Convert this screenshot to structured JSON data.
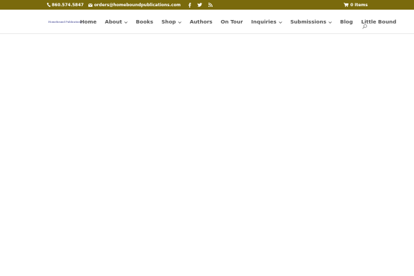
{
  "topbar": {
    "phone": "860.574.5847",
    "email": "orders@homeboundpublications.com",
    "social_icons": [
      "facebook-icon",
      "twitter-icon",
      "rss-icon"
    ],
    "cart_label": "0 Items",
    "background_color": "#7a6a0c"
  },
  "header": {
    "logo_text": "Homebound Publications",
    "nav": [
      {
        "label": "Home",
        "has_dropdown": false
      },
      {
        "label": "About",
        "has_dropdown": true
      },
      {
        "label": "Books",
        "has_dropdown": false
      },
      {
        "label": "Shop",
        "has_dropdown": true
      },
      {
        "label": "Authors",
        "has_dropdown": false
      },
      {
        "label": "On Tour",
        "has_dropdown": false
      },
      {
        "label": "Inquiries",
        "has_dropdown": true
      },
      {
        "label": "Submissions",
        "has_dropdown": true
      },
      {
        "label": "Blog",
        "has_dropdown": false
      },
      {
        "label": "Little Bound",
        "has_dropdown": false
      }
    ],
    "search_icon": "search-icon"
  }
}
